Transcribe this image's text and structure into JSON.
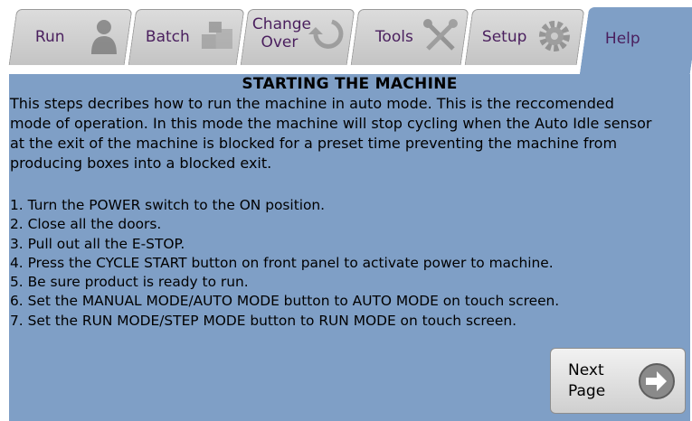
{
  "tabs": [
    {
      "label": "Run",
      "icon": "operator-icon",
      "active": false
    },
    {
      "label": "Batch",
      "icon": "boxes-icon",
      "active": false
    },
    {
      "label_line1": "Change",
      "label_line2": "Over",
      "icon": "changeover-arrow-icon",
      "active": false
    },
    {
      "label": "Tools",
      "icon": "tools-icon",
      "active": false
    },
    {
      "label": "Setup",
      "icon": "gear-icon",
      "active": false
    },
    {
      "label": "Help",
      "icon": "info-magnifier-icon",
      "active": true
    }
  ],
  "help": {
    "title": "STARTING THE MACHINE",
    "intro_lines": [
      "This steps decribes how to run the machine in auto mode. This is the reccomended",
      "mode of operation. In this mode the machine will stop cycling when the Auto Idle sensor",
      "at the exit of the machine is blocked for a preset time preventing the machine from",
      "producing boxes into a blocked exit."
    ],
    "steps": [
      "1. Turn the POWER switch to the ON position.",
      "2. Close all the doors.",
      "3. Pull out all the E-STOP.",
      "4. Press the CYCLE START button on front panel to activate power to machine.",
      "5. Be sure product is ready to run.",
      "6. Set the MANUAL MODE/AUTO MODE button to AUTO MODE on touch screen.",
      "7. Set the RUN MODE/STEP MODE button to RUN MODE on touch screen."
    ]
  },
  "next_button": {
    "line1": "Next",
    "line2": "Page",
    "icon": "arrow-right-circle-icon"
  },
  "colors": {
    "panel": "#7f9fc6",
    "tab": "#c8c8c8",
    "tab_text": "#4a1f5e"
  }
}
